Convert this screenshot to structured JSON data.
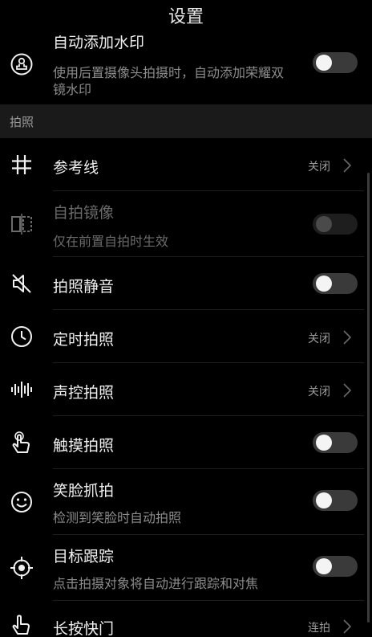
{
  "header": {
    "title": "设置"
  },
  "watermark": {
    "label": "自动添加水印",
    "desc": "使用后置摄像头拍摄时，自动添加荣耀双镜水印",
    "state": "off",
    "icon": "watermark-stamp-icon"
  },
  "section": {
    "label": "拍照"
  },
  "items": [
    {
      "label": "参考线",
      "value": "关闭",
      "icon": "grid-icon"
    },
    {
      "label": "自拍镜像",
      "desc": "仅在前置自拍时生效",
      "state": "off-disabled",
      "icon": "mirror-icon"
    },
    {
      "label": "拍照静音",
      "state": "off",
      "icon": "mute-icon"
    },
    {
      "label": "定时拍照",
      "value": "关闭",
      "icon": "timer-icon"
    },
    {
      "label": "声控拍照",
      "value": "关闭",
      "icon": "audio-wave-icon"
    },
    {
      "label": "触摸拍照",
      "state": "off",
      "icon": "touch-icon"
    },
    {
      "label": "笑脸抓拍",
      "desc": "检测到笑脸时自动拍照",
      "state": "off",
      "icon": "smile-icon"
    },
    {
      "label": "目标跟踪",
      "desc": "点击拍摄对象将自动进行跟踪和对焦",
      "state": "off",
      "icon": "target-icon"
    },
    {
      "label": "长按快门",
      "value": "连拍",
      "icon": "long-press-icon"
    }
  ],
  "colors": {
    "background": "#000000",
    "section_bg": "#1a1a1a",
    "text": "#efefef",
    "secondary": "#8c8c8c",
    "toggle_track": "#3a3a3a"
  }
}
